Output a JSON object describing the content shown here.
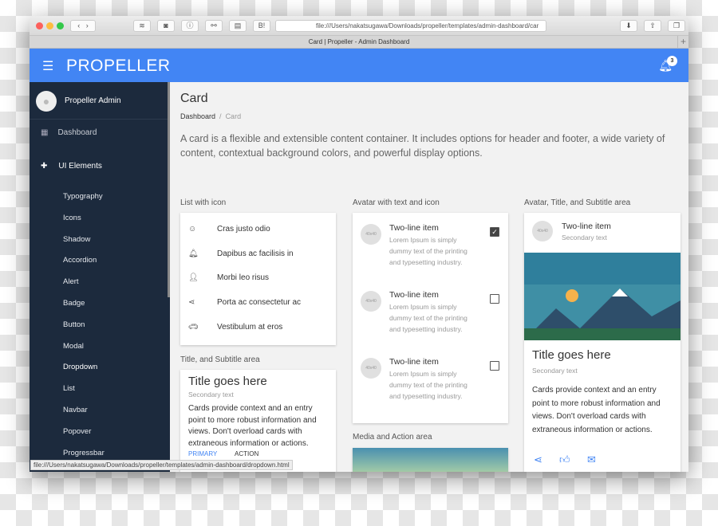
{
  "browser": {
    "url": "file:///Users/nakatsugawa/Downloads/propeller/templates/admin-dashboard/car",
    "tab_title": "Card | Propeller - Admin Dashboard",
    "status_url": "file:///Users/nakatsugawa/Downloads/propeller/templates/admin-dashboard/dropdown.html"
  },
  "header": {
    "logo": "PROPELLER",
    "notification_count": "3",
    "color": "#4285f4"
  },
  "sidebar": {
    "user": "Propeller Admin",
    "dashboard": "Dashboard",
    "ui_elements": "UI Elements",
    "items": [
      "Typography",
      "Icons",
      "Shadow",
      "Accordion",
      "Alert",
      "Badge",
      "Button",
      "Modal",
      "Dropdown",
      "List",
      "Navbar",
      "Popover",
      "Progressbar"
    ]
  },
  "page": {
    "title": "Card",
    "breadcrumb": [
      "Dashboard",
      "Card"
    ],
    "lead": "A card is a flexible and extensible content container. It includes options for header and footer, a wide variety of content, contextual background colors, and powerful display options."
  },
  "list_icon": {
    "heading": "List with icon",
    "items": [
      {
        "icon": "smile-icon",
        "label": "Cras justo odio"
      },
      {
        "icon": "bell-icon",
        "label": "Dapibus ac facilisis in"
      },
      {
        "icon": "person-add-icon",
        "label": "Morbi leo risus"
      },
      {
        "icon": "share-icon",
        "label": "Porta ac consectetur ac"
      },
      {
        "icon": "car-icon",
        "label": "Vestibulum at eros"
      }
    ]
  },
  "avatar_text": {
    "heading": "Avatar with text and icon",
    "avatar": "40x40",
    "items": [
      {
        "title": "Two-line item",
        "text": "Lorem Ipsum is simply dummy text of the printing and typesetting industry.",
        "checked": true
      },
      {
        "title": "Two-line item",
        "text": "Lorem Ipsum is simply dummy text of the printing and typesetting industry.",
        "checked": false
      },
      {
        "title": "Two-line item",
        "text": "Lorem Ipsum is simply dummy text of the printing and typesetting industry.",
        "checked": false
      }
    ]
  },
  "title_subtitle": {
    "heading": "Title, and Subtitle area",
    "title": "Title goes here",
    "subtitle": "Secondary text",
    "body": "Cards provide context and an entry point to more robust information and views. Don't overload cards with extraneous information or actions.",
    "primary": "PRIMARY",
    "action": "ACTION"
  },
  "media": {
    "heading": "Media and Action area"
  },
  "avatar_card": {
    "heading": "Avatar, Title, and Subtitle area",
    "avatar": "40x40",
    "name": "Two-line item",
    "secondary": "Secondary text",
    "title": "Title goes here",
    "subtitle": "Secondary text",
    "body": "Cards provide context and an entry point to more robust information and views. Don't overload cards with extraneous information or actions."
  }
}
